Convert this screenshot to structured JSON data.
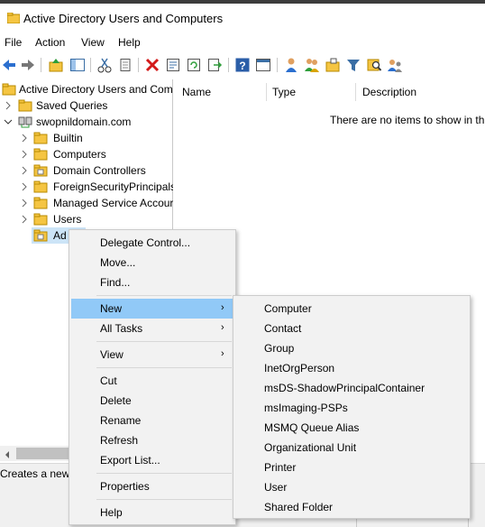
{
  "window": {
    "title": "Active Directory Users and Computers"
  },
  "menubar": {
    "items": [
      "File",
      "Action",
      "View",
      "Help"
    ]
  },
  "toolbar": {
    "buttons": [
      "back-icon",
      "forward-icon",
      "up-folder-icon",
      "console-tree-icon",
      "cut-icon",
      "copy-icon",
      "delete-icon",
      "properties-icon",
      "refresh-icon",
      "export-icon",
      "help-icon",
      "show-pane-icon",
      "new-user-icon",
      "new-group-icon",
      "new-ou-icon",
      "filter-icon",
      "find-icon",
      "add-to-group-icon"
    ]
  },
  "tree": {
    "root": "Active Directory Users and Com",
    "saved_queries": "Saved Queries",
    "domain": "swopnildomain.com",
    "children": [
      "Builtin",
      "Computers",
      "Domain Controllers",
      "ForeignSecurityPrincipals",
      "Managed Service Accour",
      "Users",
      "Ad"
    ]
  },
  "list": {
    "columns": [
      "Name",
      "Type",
      "Description"
    ],
    "empty_message": "There are no items to show in thi"
  },
  "status": {
    "text": "Creates a new i"
  },
  "context_menu": {
    "items": {
      "delegate": "Delegate Control...",
      "move": "Move...",
      "find": "Find...",
      "new": "New",
      "all_tasks": "All Tasks",
      "view": "View",
      "cut": "Cut",
      "delete": "Delete",
      "rename": "Rename",
      "refresh": "Refresh",
      "export": "Export List...",
      "properties": "Properties",
      "help": "Help"
    }
  },
  "submenu_new": {
    "items": [
      "Computer",
      "Contact",
      "Group",
      "InetOrgPerson",
      "msDS-ShadowPrincipalContainer",
      "msImaging-PSPs",
      "MSMQ Queue Alias",
      "Organizational Unit",
      "Printer",
      "User",
      "Shared Folder"
    ]
  },
  "colors": {
    "highlight": "#91c9f7",
    "menu_bg": "#f2f2f2",
    "folder": "#f5c542"
  }
}
